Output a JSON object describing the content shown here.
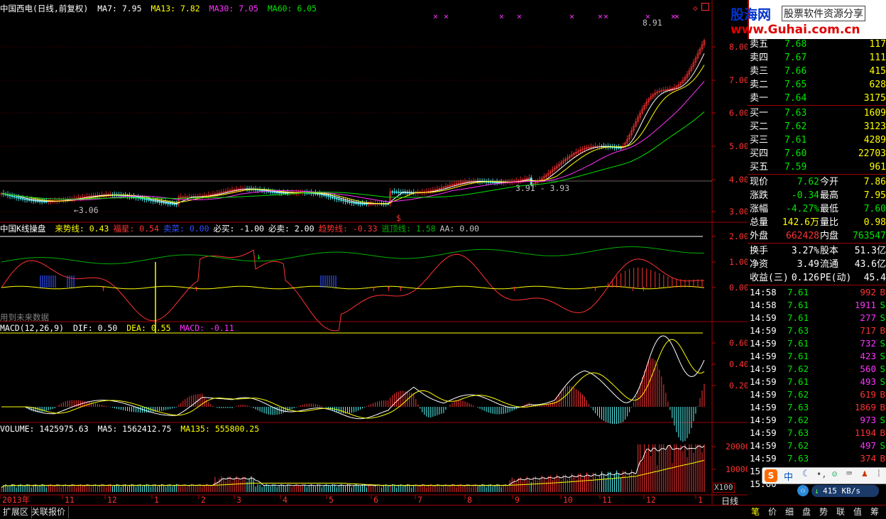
{
  "price_header": {
    "title": "中国西电(日线,前复权)",
    "ma7": "MA7: 7.95",
    "ma13": "MA13: 7.82",
    "ma30": "MA30: 7.05",
    "ma60": "MA60: 6.05"
  },
  "price_annotations": {
    "high": "8.91",
    "low": "←3.06",
    "range": "3.91 - 3.93",
    "dollar": "$"
  },
  "price_axis": [
    "8.00",
    "7.00",
    "6.00",
    "5.00",
    "4.00",
    "3.00"
  ],
  "k_header": {
    "title": "中国K线操盘",
    "items": [
      {
        "label": "来势线: 0.43",
        "color": "#ffff00"
      },
      {
        "label": "福星: 0.54",
        "color": "#ff3232"
      },
      {
        "label": "卖菜: 0.00",
        "color": "#3250ff"
      },
      {
        "label": "必买: -1.00",
        "color": "#ffffff"
      },
      {
        "label": "必卖: 2.00",
        "color": "#ffffff"
      },
      {
        "label": "趋势线: -0.33",
        "color": "#ff3232"
      },
      {
        "label": "逃顶线: 1.58",
        "color": "#00b000"
      },
      {
        "label": "AA: 0.00",
        "color": "#c0c0c0"
      }
    ],
    "note": "用到未来数据"
  },
  "k_axis": [
    "2.00",
    "1.00",
    "0.00"
  ],
  "macd_header": {
    "title": "MACD(12,26,9)",
    "dif": "DIF: 0.50",
    "dea": "DEA: 0.55",
    "macd": "MACD: -0.11"
  },
  "macd_axis": [
    "0.60",
    "0.40",
    "0.20"
  ],
  "vol_header": {
    "volume": "VOLUME: 1425975.63",
    "ma5": "MA5: 1562412.75",
    "ma135": "MA135: 555800.25"
  },
  "vol_axis": [
    "20000",
    "10000"
  ],
  "vol_unit": "X100",
  "date_axis": [
    "2013年",
    "11",
    "12",
    "1",
    "2",
    "3",
    "4",
    "5",
    "6",
    "7",
    "8",
    "9",
    "10",
    "11",
    "12",
    "1"
  ],
  "period_label": "日线",
  "bottom_tabs": [
    "扩展区",
    "关联报价"
  ],
  "brand": {
    "name": "股海网",
    "slogan": "股票软件资源分享",
    "url": "www.Guhai.com.cn"
  },
  "order_book": {
    "asks": [
      {
        "label": "卖五",
        "price": "7.68",
        "vol": "117"
      },
      {
        "label": "卖四",
        "price": "7.67",
        "vol": "111"
      },
      {
        "label": "卖三",
        "price": "7.66",
        "vol": "415"
      },
      {
        "label": "卖二",
        "price": "7.65",
        "vol": "628"
      },
      {
        "label": "卖一",
        "price": "7.64",
        "vol": "3175"
      }
    ],
    "bids": [
      {
        "label": "买一",
        "price": "7.63",
        "vol": "1609"
      },
      {
        "label": "买二",
        "price": "7.62",
        "vol": "3123"
      },
      {
        "label": "买三",
        "price": "7.61",
        "vol": "4289"
      },
      {
        "label": "买四",
        "price": "7.60",
        "vol": "22703"
      },
      {
        "label": "买五",
        "price": "7.59",
        "vol": "961"
      }
    ]
  },
  "quote": [
    {
      "l1": "现价",
      "v1": "7.62",
      "l2": "今开",
      "v2": "7.86"
    },
    {
      "l1": "涨跌",
      "v1": "-0.34",
      "l2": "最高",
      "v2": "7.95"
    },
    {
      "l1": "涨幅",
      "v1": "-4.27%",
      "l2": "最低",
      "v2": "7.60"
    },
    {
      "l1": "总量",
      "v1": "142.6万",
      "l2": "量比",
      "v2": "0.98"
    },
    {
      "l1": "外盘",
      "v1": "662428",
      "l2": "内盘",
      "v2": "763547"
    }
  ],
  "stats": [
    {
      "l1": "换手",
      "v1": "3.27%",
      "l2": "股本",
      "v2": "51.3亿"
    },
    {
      "l1": "净资",
      "v1": "3.49",
      "l2": "流通",
      "v2": "43.6亿"
    },
    {
      "l1": "收益(三)",
      "v1": "0.126",
      "l2": "PE(动)",
      "v2": "45.4"
    }
  ],
  "ticks": [
    {
      "time": "14:58",
      "price": "7.61",
      "vol": "992",
      "side": "B"
    },
    {
      "time": "14:58",
      "price": "7.61",
      "vol": "1911",
      "side": "S"
    },
    {
      "time": "14:59",
      "price": "7.61",
      "vol": "277",
      "side": "S"
    },
    {
      "time": "14:59",
      "price": "7.63",
      "vol": "717",
      "side": "B"
    },
    {
      "time": "14:59",
      "price": "7.61",
      "vol": "732",
      "side": "S"
    },
    {
      "time": "14:59",
      "price": "7.61",
      "vol": "423",
      "side": "S"
    },
    {
      "time": "14:59",
      "price": "7.62",
      "vol": "560",
      "side": "S"
    },
    {
      "time": "14:59",
      "price": "7.61",
      "vol": "493",
      "side": "S"
    },
    {
      "time": "14:59",
      "price": "7.62",
      "vol": "619",
      "side": "B"
    },
    {
      "time": "14:59",
      "price": "7.63",
      "vol": "1869",
      "side": "B"
    },
    {
      "time": "14:59",
      "price": "7.62",
      "vol": "973",
      "side": "S"
    },
    {
      "time": "14:59",
      "price": "7.63",
      "vol": "1194",
      "side": "B"
    },
    {
      "time": "14:59",
      "price": "7.62",
      "vol": "497",
      "side": "S"
    },
    {
      "time": "14:59",
      "price": "7.63",
      "vol": "374",
      "side": "B"
    },
    {
      "time": "15:00",
      "price": "",
      "vol": "",
      "side": ""
    },
    {
      "time": "15:00",
      "price": "",
      "vol": "",
      "side": ""
    }
  ],
  "ime_bar": {
    "label": "中",
    "speed": "415 KB/s"
  },
  "right_tabs": [
    "笔",
    "价",
    "细",
    "盘",
    "势",
    "联",
    "值",
    "筹"
  ]
}
